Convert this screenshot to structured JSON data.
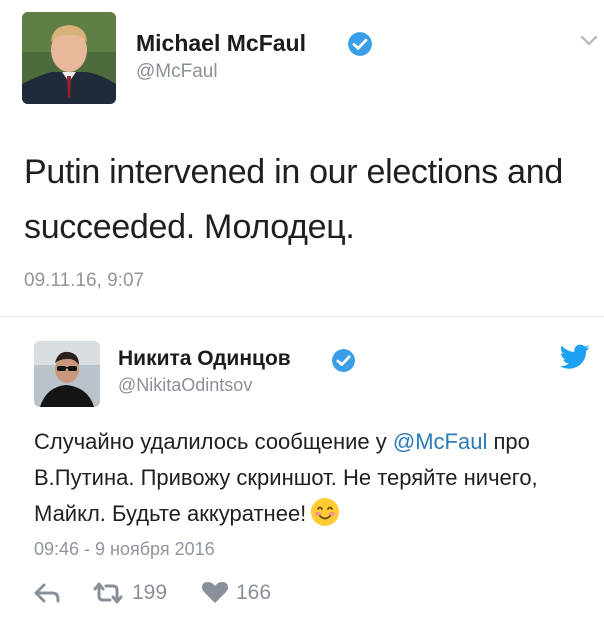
{
  "tweet1": {
    "name": "Michael McFaul",
    "handle": "@McFaul",
    "text": "Putin intervened in our elections and succeeded. Молодец.",
    "timestamp": "09.11.16, 9:07",
    "icons": {
      "verified": "verified-badge-icon",
      "menu": "chevron-down-icon"
    }
  },
  "tweet2": {
    "name": "Никита Одинцов",
    "handle": "@NikitaOdintsov",
    "text_before": "Случайно удалилось сообщение у ",
    "mention": "@McFaul",
    "text_after": " про В.Путина. Привожу скриншот. Не теряйте ничего, Майкл. Будьте аккуратнее!",
    "timestamp": "09:46 - 9 ноября 2016",
    "retweets": "199",
    "likes": "166",
    "icons": {
      "verified": "verified-badge-icon",
      "brand": "twitter-bird-icon",
      "reply": "reply-icon",
      "retweet": "retweet-icon",
      "like": "heart-icon",
      "emoji": "smiling-face-emoji"
    }
  },
  "colors": {
    "verified": "#3a9fe8",
    "twitter_blue": "#1da1f2",
    "mention": "#2b7bb9",
    "muted": "#8a9099",
    "text": "#1f1f1f"
  }
}
